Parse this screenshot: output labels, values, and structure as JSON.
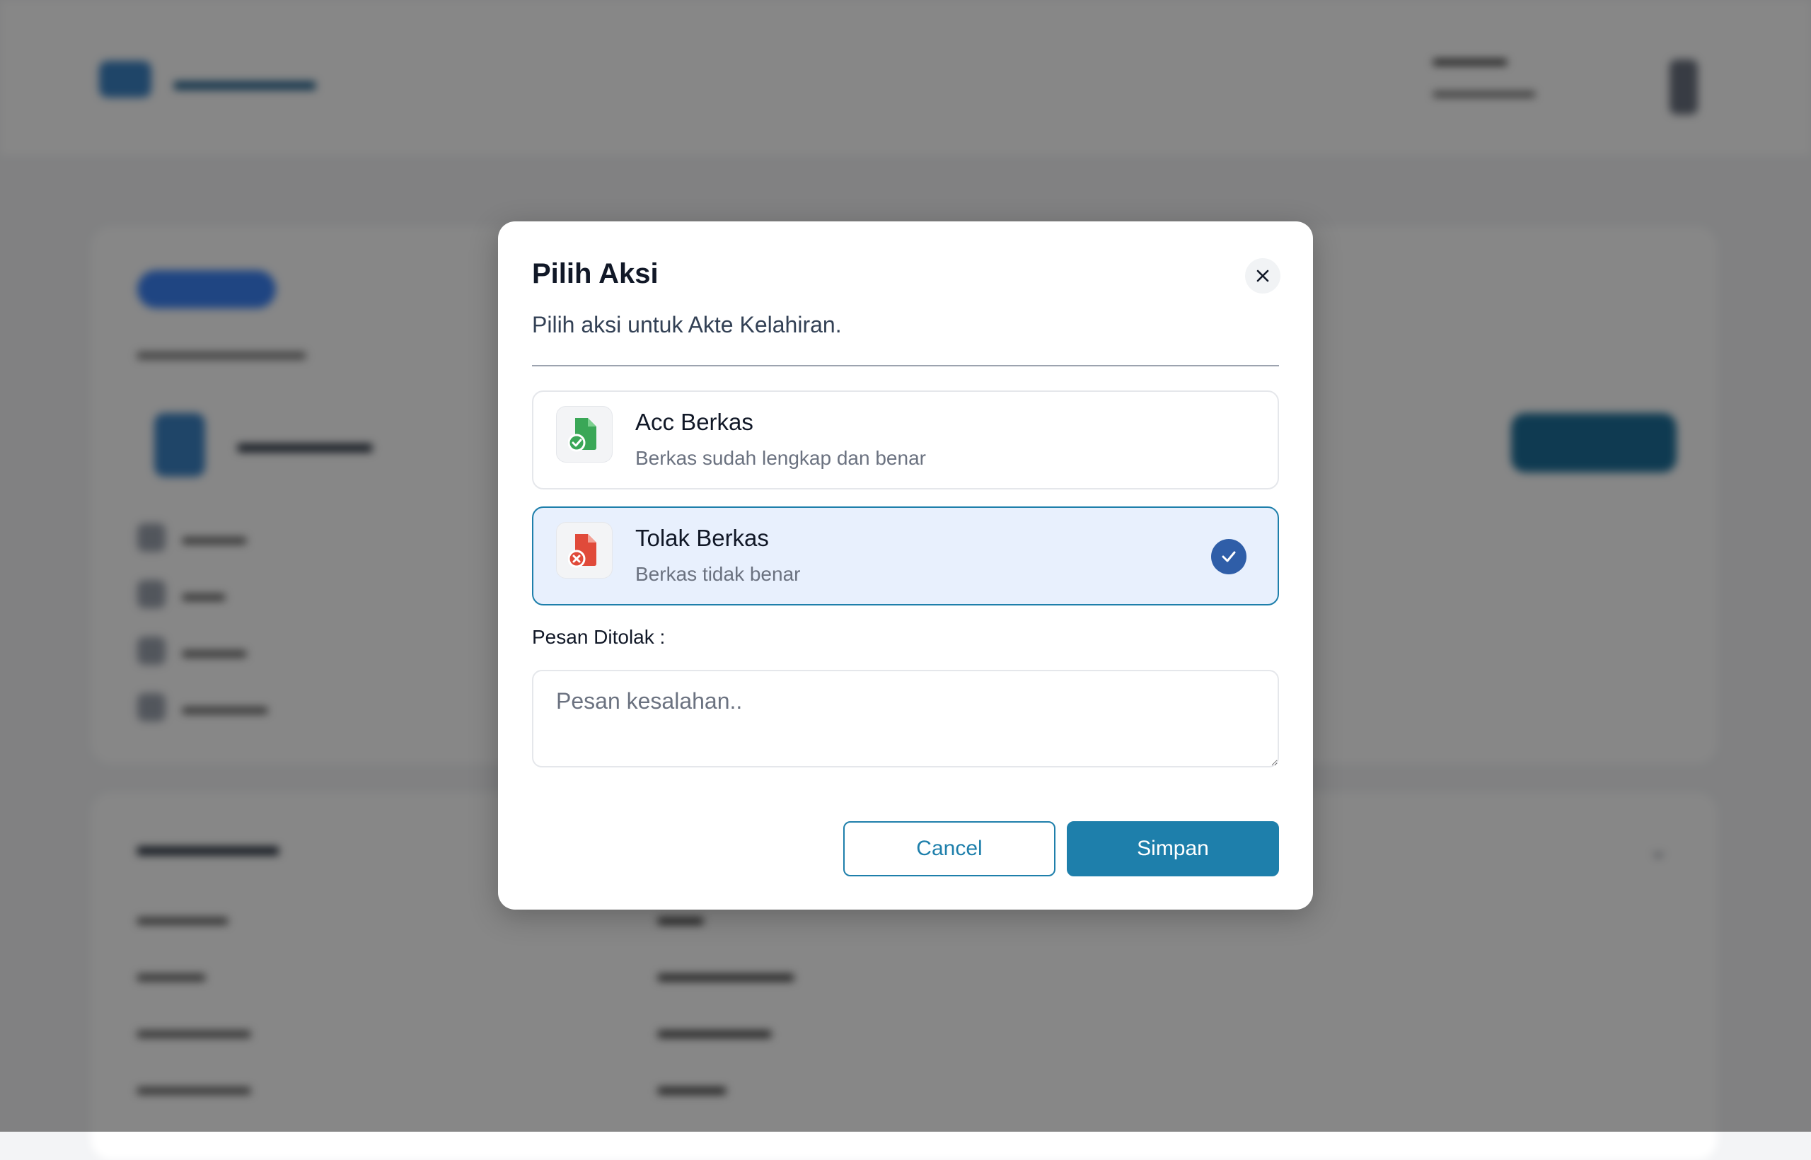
{
  "modal": {
    "title": "Pilih Aksi",
    "subtitle": "Pilih aksi untuk Akte Kelahiran.",
    "options": [
      {
        "label": "Acc Berkas",
        "description": "Berkas sudah lengkap dan benar",
        "icon": "file-check-icon",
        "color": "#3aa757",
        "selected": false
      },
      {
        "label": "Tolak Berkas",
        "description": "Berkas tidak benar",
        "icon": "file-x-icon",
        "color": "#e04a3a",
        "selected": true
      }
    ],
    "reason": {
      "label": "Pesan Ditolak :",
      "placeholder": "Pesan kesalahan..",
      "value": ""
    },
    "buttons": {
      "cancel": "Cancel",
      "save": "Simpan"
    }
  },
  "colors": {
    "primary": "#1e7fab",
    "selected_bg": "#e8f0fd",
    "check": "#2f5ea8",
    "overlay": "rgba(0,0,0,0.47)"
  }
}
